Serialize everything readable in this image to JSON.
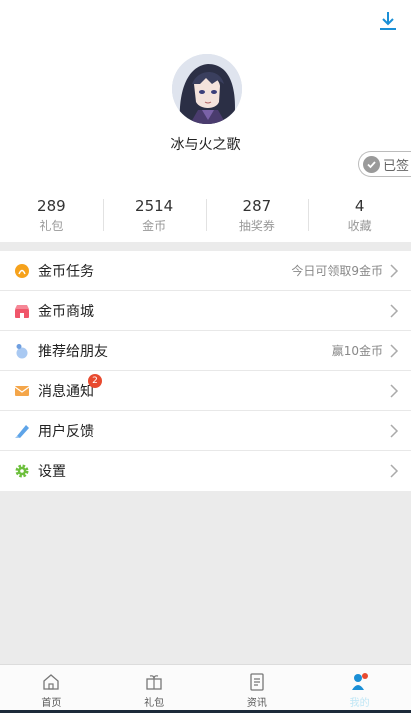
{
  "profile": {
    "username": "冰与火之歌",
    "checkin_label": "已签"
  },
  "stats": [
    {
      "value": "289",
      "label": "礼包"
    },
    {
      "value": "2514",
      "label": "金币"
    },
    {
      "value": "287",
      "label": "抽奖券"
    },
    {
      "value": "4",
      "label": "收藏"
    }
  ],
  "menu": [
    {
      "title": "金币任务",
      "hint": "今日可领取9金币",
      "icon": "coin-icon"
    },
    {
      "title": "金币商城",
      "hint": "",
      "icon": "shop-icon"
    },
    {
      "title": "推荐给朋友",
      "hint": "赢10金币",
      "icon": "share-icon"
    },
    {
      "title": "消息通知",
      "hint": "",
      "icon": "mail-icon",
      "badge": "2"
    },
    {
      "title": "用户反馈",
      "hint": "",
      "icon": "feedback-pen-icon"
    },
    {
      "title": "设置",
      "hint": "",
      "icon": "gear-icon"
    }
  ],
  "tabs": [
    {
      "label": "首页",
      "icon": "home-icon"
    },
    {
      "label": "礼包",
      "icon": "gift-icon"
    },
    {
      "label": "资讯",
      "icon": "news-icon"
    },
    {
      "label": "我的",
      "icon": "profile-icon",
      "active": true
    }
  ],
  "colors": {
    "accent": "#1a8fd6",
    "badge": "#e84a2f",
    "coin": "#f6a21c",
    "shop": "#f0566a",
    "settings": "#6cbf3c"
  }
}
